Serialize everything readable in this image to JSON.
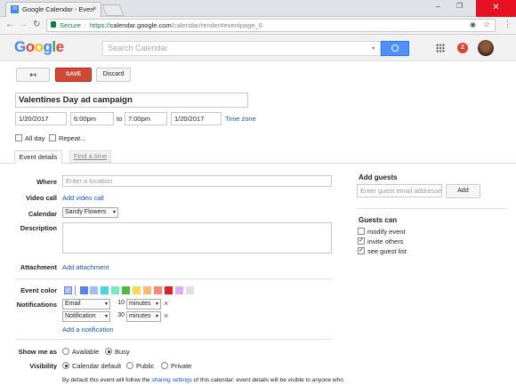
{
  "browser": {
    "tab_title": "Google Calendar - Even",
    "tab_favicon": "20",
    "secure_label": "Secure",
    "url_scheme": "https://",
    "url_host": "calendar.google.com",
    "url_path": "/calendar/render#eventpage_6"
  },
  "header": {
    "logo": "Google",
    "search_placeholder": "Search Calendar",
    "notification_count": "2"
  },
  "toolbar": {
    "back_icon": "↤",
    "save_label": "SAVE",
    "discard_label": "Discard"
  },
  "event": {
    "title": "Valentines Day ad campaign",
    "start_date": "1/20/2017",
    "start_time": "6:00pm",
    "to_label": "to",
    "end_time": "7:00pm",
    "end_date": "1/20/2017",
    "timezone_link": "Time zone",
    "allday_label": "All day",
    "repeat_label": "Repeat..."
  },
  "tabs": {
    "details": "Event details",
    "find_time": "Find a time"
  },
  "form": {
    "where_label": "Where",
    "where_placeholder": "Enter a location",
    "video_label": "Video call",
    "video_link": "Add video call",
    "calendar_label": "Calendar",
    "calendar_value": "Sandy Flowers",
    "description_label": "Description",
    "attachment_label": "Attachment",
    "attachment_link": "Add attachment",
    "color_label": "Event color",
    "colors": [
      "#a4bdfc",
      "#5484ed",
      "#a4bdfc",
      "#46d6db",
      "#7ae7bf",
      "#51b749",
      "#fbd75b",
      "#ffb878",
      "#ff887c",
      "#dc2127",
      "#dbadff",
      "#e1e1e1"
    ],
    "notifications_label": "Notifications",
    "notifications": [
      {
        "method": "Email",
        "amount": "10",
        "unit": "minutes"
      },
      {
        "method": "Notification",
        "amount": "30",
        "unit": "minutes"
      }
    ],
    "add_notification": "Add a notification",
    "showme_label": "Show me as",
    "available": "Available",
    "busy": "Busy",
    "visibility_label": "Visibility",
    "vis_default": "Calendar default",
    "vis_public": "Public",
    "vis_private": "Private",
    "footer_text_a": "By default this event will follow the",
    "footer_link": "sharing settings",
    "footer_text_b": "of this calendar: event details will be visible to anyone who"
  },
  "guests": {
    "title": "Add guests",
    "placeholder": "Enter guest email addresses",
    "add_button": "Add",
    "can_title": "Guests can",
    "perms": [
      {
        "label": "modify event",
        "checked": false
      },
      {
        "label": "invite others",
        "checked": true
      },
      {
        "label": "see guest list",
        "checked": true
      }
    ]
  }
}
